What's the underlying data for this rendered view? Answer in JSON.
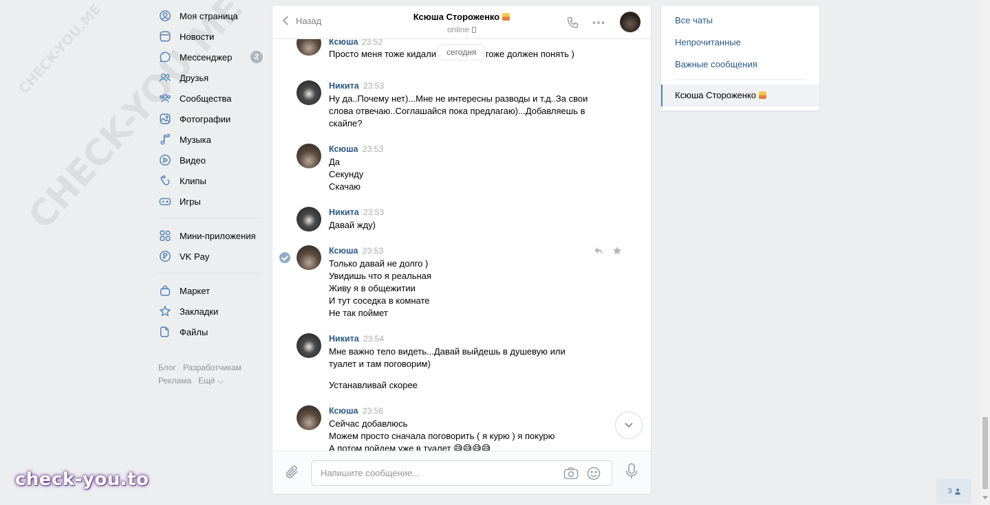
{
  "watermarks": {
    "diag_small": "CHECK-YOU.ME",
    "diag_large": "CHECK-YOU.ME",
    "bottom": "check-you.to"
  },
  "leftnav": {
    "items": [
      {
        "label": "Моя страница",
        "icon": "user-circle-icon"
      },
      {
        "label": "Новости",
        "icon": "news-icon"
      },
      {
        "label": "Мессенджер",
        "icon": "chat-bubble-icon",
        "badge": "2"
      },
      {
        "label": "Друзья",
        "icon": "friends-icon"
      },
      {
        "label": "Сообщества",
        "icon": "communities-icon"
      },
      {
        "label": "Фотографии",
        "icon": "photo-icon"
      },
      {
        "label": "Музыка",
        "icon": "music-note-icon"
      },
      {
        "label": "Видео",
        "icon": "play-circle-icon"
      },
      {
        "label": "Клипы",
        "icon": "clips-icon"
      },
      {
        "label": "Игры",
        "icon": "gamepad-icon"
      }
    ],
    "items2": [
      {
        "label": "Мини-приложения",
        "icon": "grid-icon"
      },
      {
        "label": "VK Pay",
        "icon": "ruble-circle-icon"
      }
    ],
    "items3": [
      {
        "label": "Маркет",
        "icon": "shopping-bag-icon"
      },
      {
        "label": "Закладки",
        "icon": "star-icon"
      },
      {
        "label": "Файлы",
        "icon": "file-icon"
      }
    ],
    "footer": [
      "Блог",
      "Разработчикам",
      "Реклама",
      "Ещё ⌵"
    ]
  },
  "chat": {
    "back_label": "Назад",
    "peer_name": "Ксюша Стороженко",
    "peer_status": "online",
    "date_pill": "сегодня",
    "composer_placeholder": "Напишите сообщение...",
    "messages": [
      {
        "author": "Ксюша",
        "time": "23:52",
        "lines": [
          "Просто меня тоже кидали много раз) тоже должен понять )"
        ]
      },
      {
        "author": "Никита",
        "time": "23:53",
        "lines": [
          "Ну да..Почему нет)...Мне не интересны разводы и т.д..За свои",
          "слова отвечаю..Соглашайся пока предлагаю)...Добавляешь в",
          "скайпе?"
        ]
      },
      {
        "author": "Ксюша",
        "time": "23:53",
        "lines": [
          "Да",
          "Секунду",
          "Скачаю"
        ]
      },
      {
        "author": "Никита",
        "time": "23:53",
        "lines": [
          "Давай жду)"
        ]
      },
      {
        "author": "Ксюша",
        "time": "23:53",
        "lines": [
          "Только давай не долго )",
          "Увидишь что я реальная",
          "Живу я в общежитии",
          "И тут соседка в комнате",
          "Не так поймет"
        ]
      },
      {
        "author": "Никита",
        "time": "23:54",
        "lines": [
          "Мне важно тело видеть...Давай выйдешь в душевую или",
          "туалет и там поговорим)",
          "Устанавливай скорее"
        ]
      },
      {
        "author": "Ксюша",
        "time": "23:56",
        "lines": [
          "Сейчас добавлюсь",
          "Можем просто сначала поговорить ( я курю ) я покурю",
          "А потом пойдем уже в туалет 😅😅😅😅"
        ]
      }
    ]
  },
  "rightpanel": {
    "items": [
      "Все чаты",
      "Непрочитанные",
      "Важные сообщения"
    ],
    "active_chat": "Ксюша Стороженко"
  },
  "online_count": "3",
  "colors": {
    "accent": "#5181b8",
    "author": "#2a5885",
    "background": "#edeef0"
  }
}
